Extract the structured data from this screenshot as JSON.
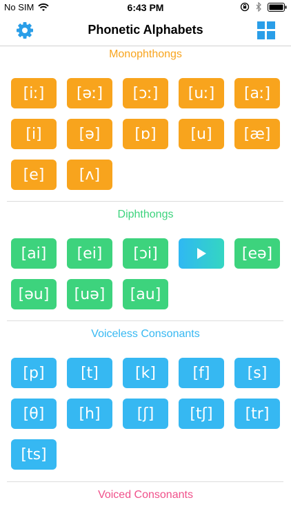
{
  "status": {
    "carrier": "No SIM",
    "time": "6:43 PM"
  },
  "nav": {
    "title": "Phonetic Alphabets"
  },
  "sections": {
    "monophthongs": {
      "title": "Monophthongs",
      "color": "#f8a41d",
      "keys": [
        "[iː]",
        "[əː]",
        "[ɔː]",
        "[uː]",
        "[aː]",
        "[i]",
        "[ə]",
        "[ɒ]",
        "[u]",
        "[æ]",
        "[e]",
        "[ʌ]"
      ]
    },
    "diphthongs": {
      "title": "Diphthongs",
      "color": "#3dd37d",
      "keys": [
        "[ai]",
        "[ei]",
        "[ɔi]",
        "",
        "[eə]",
        "[əu]",
        "[uə]",
        "[au]"
      ],
      "playing_index": 3
    },
    "voiceless": {
      "title": "Voiceless Consonants",
      "color": "#36b8f2",
      "keys": [
        "[p]",
        "[t]",
        "[k]",
        "[f]",
        "[s]",
        "[θ]",
        "[h]",
        "[ʃ]",
        "[tʃ]",
        "[tr]",
        "[ts]"
      ]
    },
    "voiced": {
      "title": "Voiced Consonants",
      "color": "#f0508a"
    }
  }
}
